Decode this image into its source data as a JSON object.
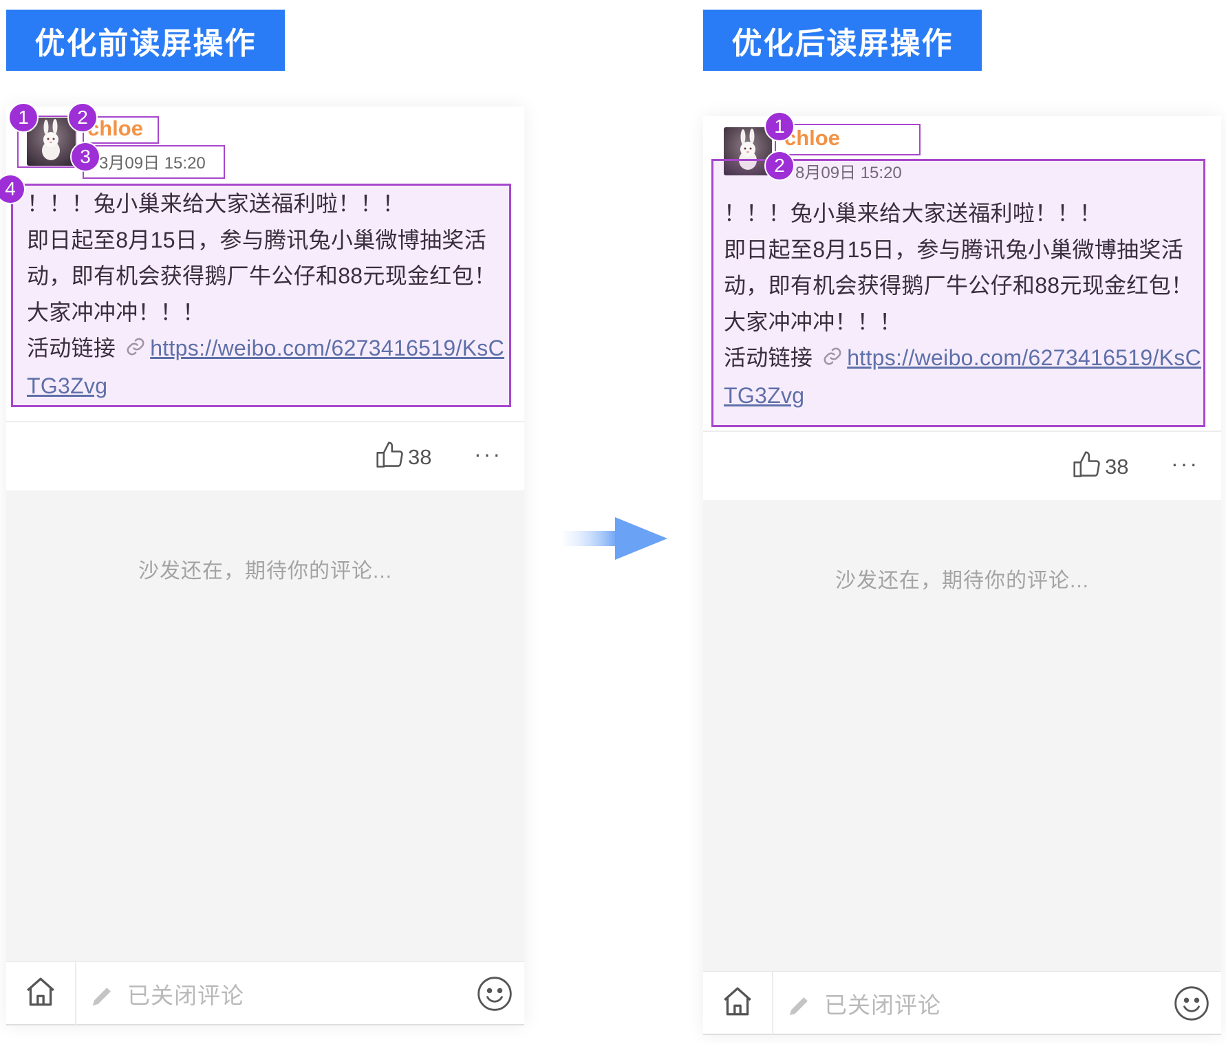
{
  "labels": {
    "before": "优化前读屏操作",
    "after": "优化后读屏操作"
  },
  "post": {
    "username": "chloe",
    "datetime": "8月09日 15:20",
    "datetime_before_visible": "3月09日 15:20",
    "lines": [
      "！！！兔小巢来给大家送福利啦！！！",
      "即日起至8月15日，参与腾讯兔小巢微博抽奖活动，即有机会获得鹅厂牛公仔和88元现金红包！",
      "大家冲冲冲！！！"
    ],
    "link_label": "活动链接",
    "link_url": "https://weibo.com/6273416519/KsCTG3Zvg",
    "likes": "38",
    "more": "···"
  },
  "comments": {
    "empty_text": "沙发还在，期待你的评论..."
  },
  "bottom_bar": {
    "closed_text": "已关闭评论"
  },
  "badges": {
    "before": [
      "1",
      "2",
      "3",
      "4"
    ],
    "after": [
      "1",
      "2"
    ]
  },
  "icons": {
    "like": "thumbs-up-icon",
    "link": "link-icon",
    "home": "home-icon",
    "pencil": "pencil-icon",
    "emoji": "smiley-face-icon",
    "more": "more-dots-icon",
    "arrow": "right-arrow-icon"
  },
  "colors": {
    "tag_bg": "#2a7cf6",
    "username": "#f39245",
    "highlight": "#a846cc",
    "badge": "#9e2fd6",
    "link": "#4d6fa0"
  }
}
